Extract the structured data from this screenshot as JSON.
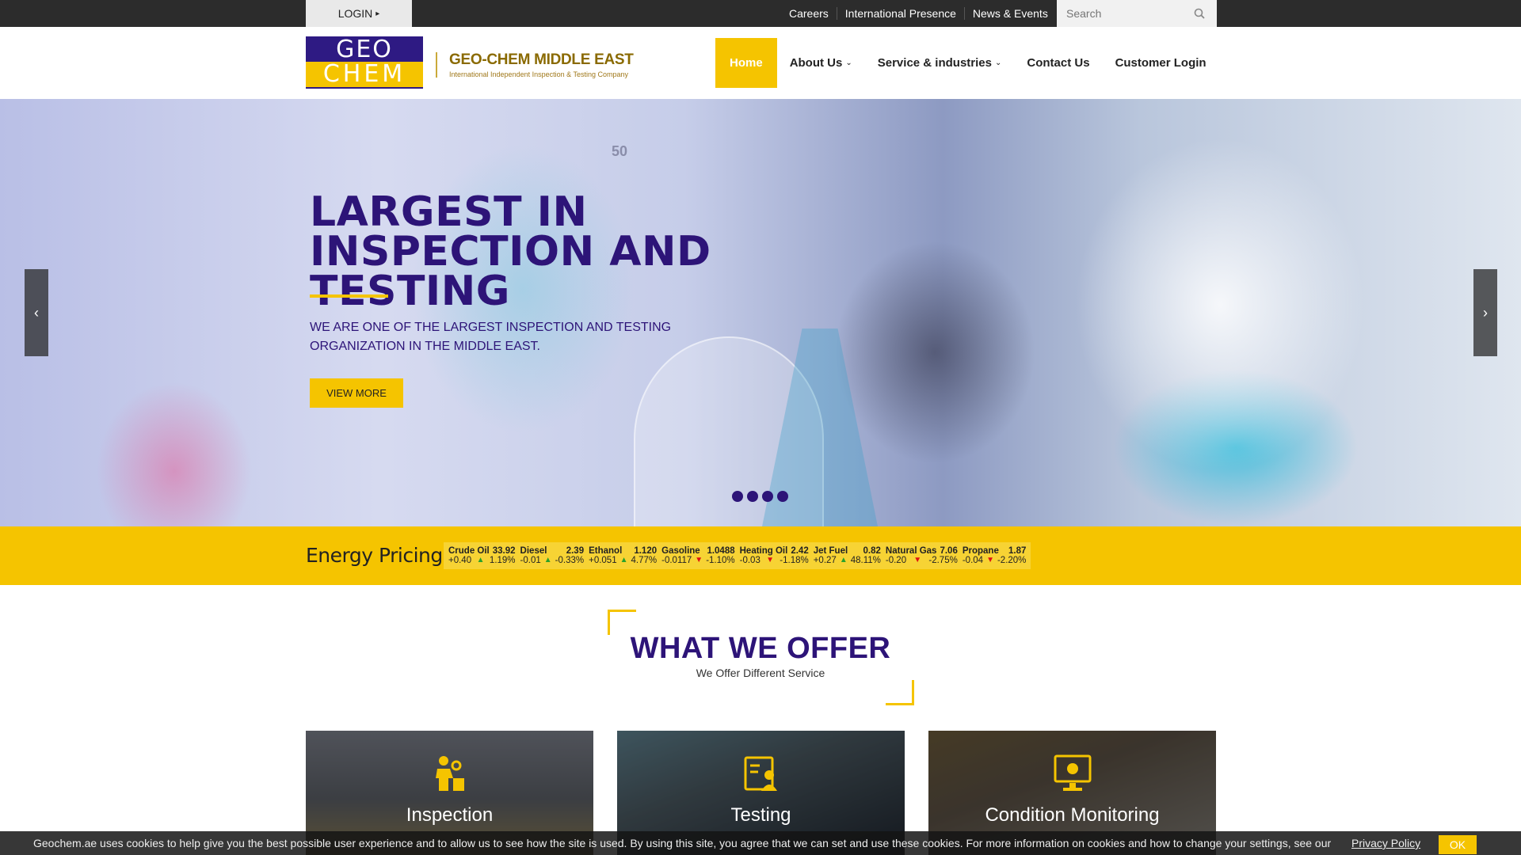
{
  "topbar": {
    "login_label": "LOGIN",
    "links": [
      "Careers",
      "International Presence",
      "News & Events"
    ],
    "search_placeholder": "Search"
  },
  "header": {
    "logo_line1": "GEO",
    "logo_line2": "CHEM",
    "company_name": "GEO-CHEM MIDDLE EAST",
    "company_tagline": "International Independent Inspection & Testing Company",
    "nav": [
      "Home",
      "About Us",
      "Service & industries",
      "Contact Us",
      "Customer Login"
    ]
  },
  "hero": {
    "title": "LARGEST IN INSPECTION AND TESTING",
    "subtitle": "WE ARE ONE OF THE LARGEST INSPECTION AND TESTING ORGANIZATION IN THE MIDDLE EAST.",
    "button_label": "VIEW MORE",
    "slide_count": 4,
    "beaker_label": "50"
  },
  "energy": {
    "label": "Energy Pricing :",
    "items": [
      {
        "name": "Crude Oil",
        "price": "33.92",
        "change": "+0.40",
        "direction": "up",
        "pct": "1.19%"
      },
      {
        "name": "Diesel",
        "price": "2.39",
        "change": "-0.01",
        "direction": "up",
        "pct": "-0.33%"
      },
      {
        "name": "Ethanol",
        "price": "1.120",
        "change": "+0.051",
        "direction": "up",
        "pct": "4.77%"
      },
      {
        "name": "Gasoline",
        "price": "1.0488",
        "change": "-0.0117",
        "direction": "down",
        "pct": "-1.10%"
      },
      {
        "name": "Heating Oil",
        "price": "2.42",
        "change": "-0.03",
        "direction": "down",
        "pct": "-1.18%"
      },
      {
        "name": "Jet Fuel",
        "price": "0.82",
        "change": "+0.27",
        "direction": "up",
        "pct": "48.11%"
      },
      {
        "name": "Natural Gas",
        "price": "7.06",
        "change": "-0.20",
        "direction": "down",
        "pct": "-2.75%"
      },
      {
        "name": "Propane",
        "price": "1.87",
        "change": "-0.04",
        "direction": "down",
        "pct": "-2.20%"
      }
    ],
    "colors": {
      "up": "#2aa12a",
      "down": "#dd1111",
      "accent": "#f5c400",
      "brand": "#2d1478"
    }
  },
  "offer": {
    "title": "WHAT WE OFFER",
    "subtitle": "We Offer Different Service",
    "cards": [
      {
        "label": "Inspection",
        "icon": "inspector-icon"
      },
      {
        "label": "Testing",
        "icon": "report-user-icon"
      },
      {
        "label": "Condition Monitoring",
        "icon": "monitor-gear-icon"
      }
    ]
  },
  "cookie": {
    "message": "Geochem.ae uses cookies to help give you the best possible user experience and to allow us to see how the site is used. By using this site, you agree that we can set and use these cookies. For more information on cookies and how to change your settings, see our",
    "policy_label": "Privacy Policy",
    "ok_label": "OK"
  }
}
